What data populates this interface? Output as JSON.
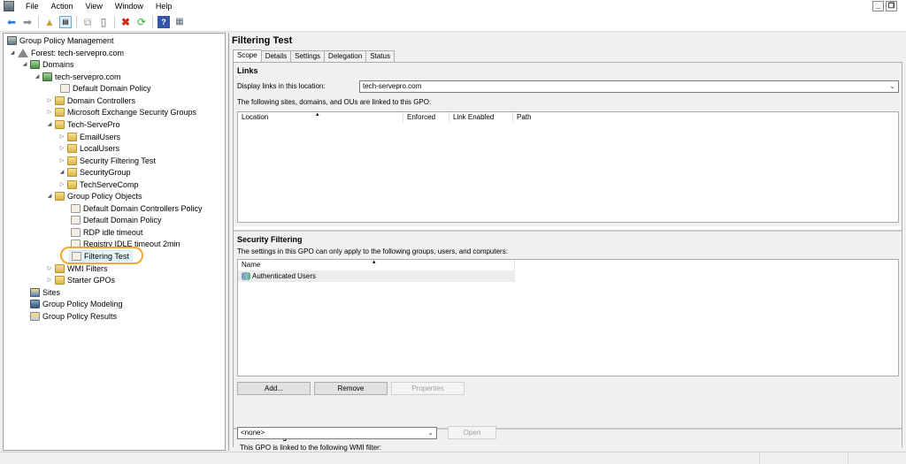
{
  "menubar": {
    "items": [
      "File",
      "Action",
      "View",
      "Window",
      "Help"
    ]
  },
  "toolbar": {
    "icons": [
      "back-icon",
      "forward-icon",
      "up-folder-icon",
      "show-hide-tree-icon",
      "copy-icon",
      "paste-icon",
      "delete-icon",
      "refresh-icon",
      "help-icon",
      "console-icon"
    ]
  },
  "tree": {
    "root": "Group Policy Management",
    "forest": "Forest: tech-servepro.com",
    "domains": "Domains",
    "domain": "tech-servepro.com",
    "default_domain_policy_link": "Default Domain Policy",
    "domain_controllers": "Domain Controllers",
    "exchange_groups": "Microsoft Exchange Security Groups",
    "tech_servepro": "Tech-ServePro",
    "email_users": "EmailUsers",
    "local_users": "LocalUsers",
    "security_filtering_test": "Security Filtering Test",
    "security_group": "SecurityGroup",
    "techserve_comp": "TechServeComp",
    "gpo_container": "Group Policy Objects",
    "gpo_dc_policy": "Default Domain Controllers Policy",
    "gpo_domain_policy": "Default Domain Policy",
    "gpo_rdp": "RDP idle timeout",
    "gpo_registry": "Registry IDLE timeout 2min",
    "gpo_filtering": "Filtering Test",
    "wmi_filters": "WMI Filters",
    "starter_gpos": "Starter GPOs",
    "sites": "Sites",
    "modeling": "Group Policy Modeling",
    "results": "Group Policy Results"
  },
  "details": {
    "title": "Filtering Test",
    "tabs": [
      "Scope",
      "Details",
      "Settings",
      "Delegation",
      "Status"
    ],
    "links": {
      "heading": "Links",
      "display_label": "Display links in this location:",
      "location_value": "tech-servepro.com",
      "description": "The following sites, domains, and OUs are linked to this GPO:",
      "columns": [
        "Location",
        "Enforced",
        "Link Enabled",
        "Path"
      ]
    },
    "security": {
      "heading": "Security Filtering",
      "description": "The settings in this GPO can only apply to the following groups, users, and computers:",
      "column": "Name",
      "rows": [
        "Authenticated Users"
      ],
      "add": "Add...",
      "remove": "Remove",
      "properties": "Properties"
    },
    "wmi": {
      "heading": "WMI Filtering",
      "description": "This GPO is linked to the following WMI filter:",
      "value": "<none>",
      "open": "Open"
    }
  }
}
